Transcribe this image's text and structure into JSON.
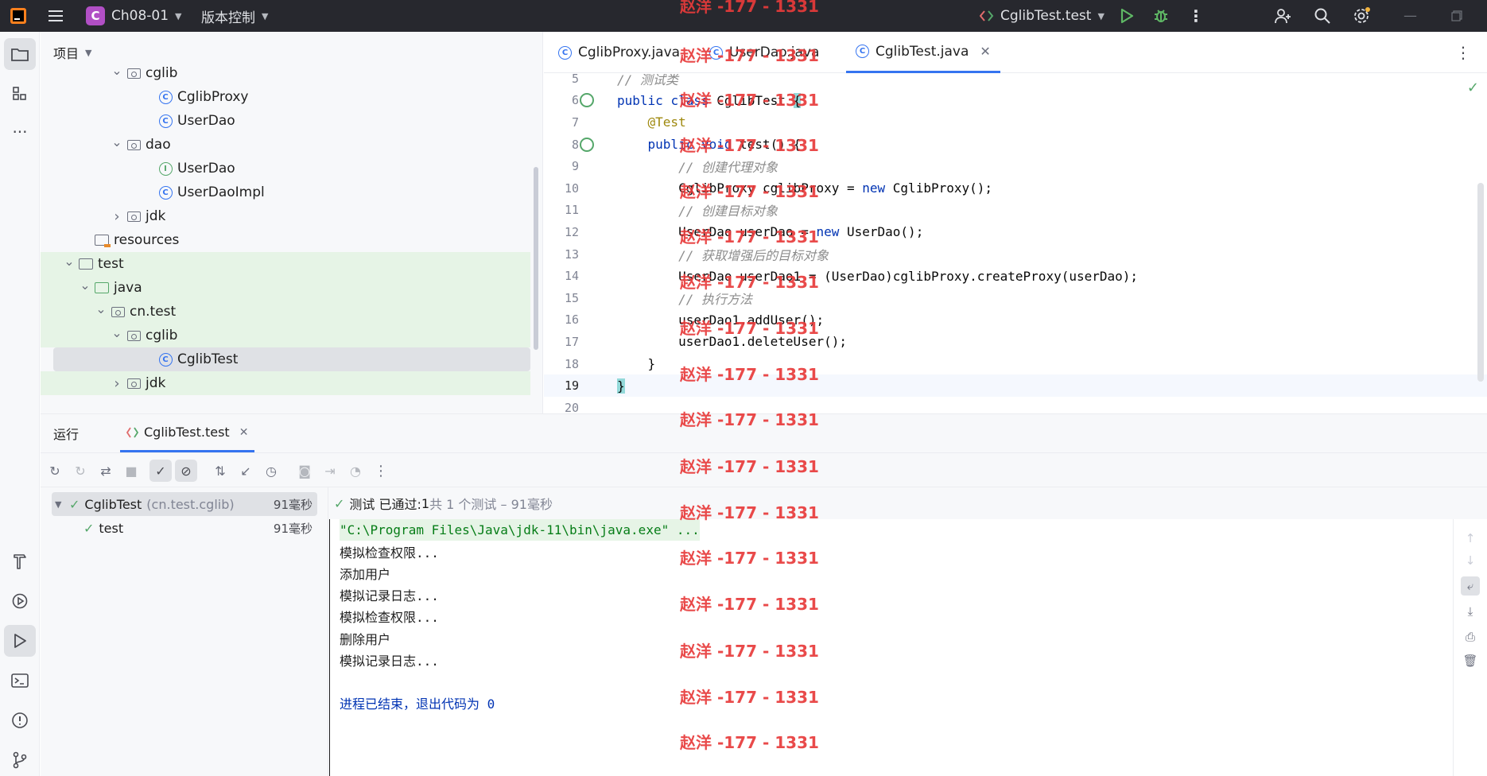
{
  "titlebar": {
    "project_initial": "C",
    "project_name": "Ch08-01",
    "vcs_label": "版本控制",
    "run_config": "CglibTest.test"
  },
  "project_panel": {
    "header": "项目",
    "rows": [
      {
        "indent": 5,
        "expanded": true,
        "icon": "package-icon",
        "label": "cglib"
      },
      {
        "indent": 7,
        "expanded": null,
        "icon": "class-icon",
        "label": "CglibProxy"
      },
      {
        "indent": 7,
        "expanded": null,
        "icon": "class-icon",
        "label": "UserDao"
      },
      {
        "indent": 5,
        "expanded": true,
        "icon": "package-icon",
        "label": "dao"
      },
      {
        "indent": 7,
        "expanded": null,
        "icon": "interface-icon",
        "label": "UserDao"
      },
      {
        "indent": 7,
        "expanded": null,
        "icon": "class-icon",
        "label": "UserDaoImpl"
      },
      {
        "indent": 5,
        "expanded": false,
        "icon": "package-icon",
        "label": "jdk"
      },
      {
        "indent": 3,
        "expanded": null,
        "icon": "resources-folder-icon",
        "label": "resources"
      },
      {
        "indent": 2,
        "expanded": true,
        "icon": "folder-icon",
        "label": "test"
      },
      {
        "indent": 3,
        "expanded": true,
        "icon": "test-folder-icon",
        "label": "java"
      },
      {
        "indent": 4,
        "expanded": true,
        "icon": "package-icon",
        "label": "cn.test"
      },
      {
        "indent": 5,
        "expanded": true,
        "icon": "package-icon",
        "label": "cglib"
      },
      {
        "indent": 7,
        "expanded": null,
        "icon": "class-icon",
        "label": "CglibTest"
      },
      {
        "indent": 5,
        "expanded": false,
        "icon": "package-icon",
        "label": "jdk"
      }
    ]
  },
  "editor": {
    "tabs": [
      {
        "label": "CglibProxy.java"
      },
      {
        "label": "UserDao.java"
      },
      {
        "label": "CglibTest.java",
        "active": true
      }
    ],
    "lines": [
      {
        "n": "5",
        "text": "// 测试类"
      },
      {
        "n": "6",
        "text": "public class CglibTest {"
      },
      {
        "n": "7",
        "text": "    @Test"
      },
      {
        "n": "8",
        "text": "    public void test() {"
      },
      {
        "n": "9",
        "text": "        // 创建代理对象"
      },
      {
        "n": "10",
        "text": "        CglibProxy cglibProxy = new CglibProxy();"
      },
      {
        "n": "11",
        "text": "        // 创建目标对象"
      },
      {
        "n": "12",
        "text": "        UserDao userDao = new UserDao();"
      },
      {
        "n": "13",
        "text": "        // 获取增强后的目标对象"
      },
      {
        "n": "14",
        "text": "        UserDao userDao1 = (UserDao)cglibProxy.createProxy(userDao);"
      },
      {
        "n": "15",
        "text": "        // 执行方法"
      },
      {
        "n": "16",
        "text": "        userDao1.addUser();"
      },
      {
        "n": "17",
        "text": "        userDao1.deleteUser();"
      },
      {
        "n": "18",
        "text": "    }"
      },
      {
        "n": "19",
        "text": "}"
      },
      {
        "n": "20",
        "text": ""
      }
    ]
  },
  "run_panel": {
    "tab_run": "运行",
    "tab_config": "CglibTest.test",
    "tree": [
      {
        "label": "CglibTest",
        "sub": "(cn.test.cglib)",
        "duration": "91毫秒"
      },
      {
        "label": "test",
        "sub": "",
        "duration": "91毫秒"
      }
    ],
    "status_prefix": "测试 已通过: ",
    "status_count": "1",
    "status_suffix": "共 1 个测试 – 91毫秒",
    "console_lines": [
      "\"C:\\Program Files\\Java\\jdk-11\\bin\\java.exe\" ...",
      "模拟检查权限...",
      "添加用户",
      "模拟记录日志...",
      "模拟检查权限...",
      "删除用户",
      "模拟记录日志...",
      "",
      "进程已结束，退出代码为 0"
    ]
  },
  "watermark": "赵洋 -177 - 1331",
  "colors": {
    "accent": "#3574f0",
    "success": "#55a76a",
    "watermark": "#e83b3b",
    "titlebar_bg": "#27282e"
  }
}
